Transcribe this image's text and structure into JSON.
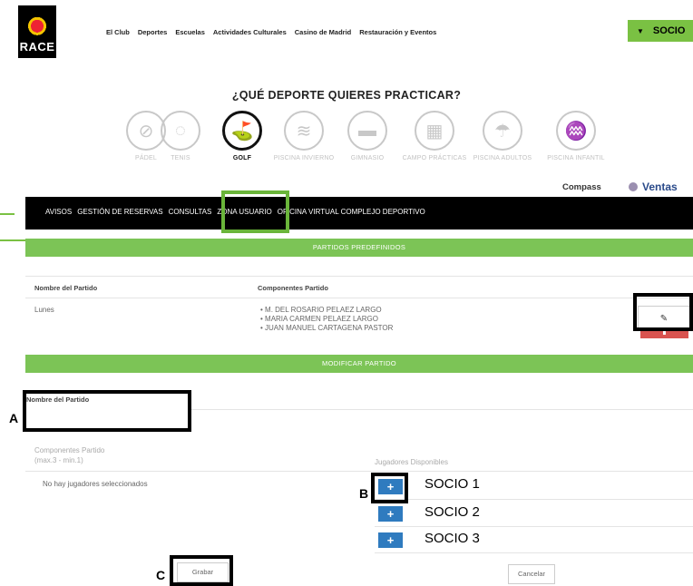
{
  "header": {
    "logo_text": "RACE",
    "nav": [
      "El Club",
      "Deportes",
      "Escuelas",
      "Actividades Culturales",
      "Casino de Madrid",
      "Restauración y Eventos"
    ],
    "socio_button": "SOCIO"
  },
  "sports": {
    "question": "¿QUÉ DEPORTE QUIERES PRACTICAR?",
    "items": [
      {
        "label": "PÁDEL",
        "icon": "padel-icon"
      },
      {
        "label": "TENIS",
        "icon": "tennis-icon"
      },
      {
        "label": "GOLF",
        "icon": "golf-icon",
        "active": true
      },
      {
        "label": "PISCINA INVIERNO",
        "icon": "pool-icon"
      },
      {
        "label": "GIMNASIO",
        "icon": "gym-icon"
      },
      {
        "label": "CAMPO PRÁCTICAS",
        "icon": "practice-range-icon"
      },
      {
        "label": "PISCINA ADULTOS",
        "icon": "beach-icon"
      },
      {
        "label": "PISCINA INFANTIL",
        "icon": "kids-pool-icon"
      }
    ]
  },
  "account": {
    "compass": "Compass",
    "ventas": "Ventas"
  },
  "menu": {
    "items": [
      "AVISOS",
      "GESTIÓN DE RESERVAS",
      "CONSULTAS",
      "ZONA USUARIO",
      "OFICINA VIRTUAL COMPLEJO DEPORTIVO"
    ],
    "highlighted": "ZONA USUARIO"
  },
  "predefined": {
    "title": "PARTIDOS PREDEFINIDOS",
    "col_name": "Nombre del Partido",
    "col_players": "Componentes Partido",
    "row": {
      "name": "Lunes",
      "players": [
        "M. DEL ROSARIO PELAEZ LARGO",
        "MARIA CARMEN PELAEZ LARGO",
        "JUAN MANUEL CARTAGENA PASTOR"
      ]
    }
  },
  "modify": {
    "title": "MODIFICAR PARTIDO",
    "name_label": "Nombre del Partido",
    "components_label": "Componentes Partido",
    "components_hint": "(max.3 - min.1)",
    "no_players": "No hay jugadores seleccionados",
    "available_label": "Jugadores Disponibles",
    "available": [
      "SOCIO 1",
      "SOCIO 2",
      "SOCIO 3"
    ],
    "save_label": "Grabar",
    "cancel_label": "Cancelar"
  },
  "annotations": {
    "a": "A",
    "b": "B",
    "c": "C"
  },
  "colors": {
    "green": "#7cc456",
    "blue": "#2f7bbf",
    "black": "#000000"
  }
}
